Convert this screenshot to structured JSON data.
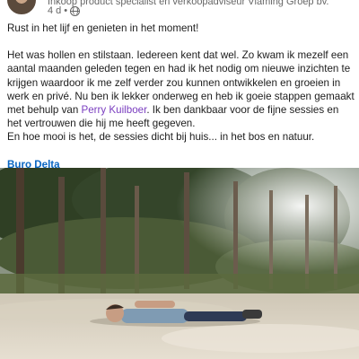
{
  "post": {
    "author_subtitle": "Inkoop product specialist en verkoopadviseur Vlaming Groep bv.",
    "time": "4 d",
    "separator": "•",
    "visibility_icon": "globe-icon",
    "line1": "Rust in het lijf en genieten in het moment!",
    "para2_part1": "Het was hollen en stilstaan. Iedereen kent dat wel. Zo kwam ik mezelf een aantal maanden geleden tegen en had ik het nodig om nieuwe inzichten te krijgen waardoor ik me zelf verder zou kunnen ontwikkelen en groeien in werk en privé. Nu ben ik lekker onderweg en heb ik goeie stappen gemaakt met behulp van ",
    "mention": "Perry Kuilboer",
    "para2_part2": ". Ik ben dankbaar voor de fijne sessies en het vertrouwen die hij me heeft gegeven.",
    "line3": "En hoe mooi is het, de sessies dicht bij huis... in het bos en natuur.",
    "hashtag": "Buro Delta"
  },
  "colors": {
    "mention": "#7b3fc0",
    "link": "#0a66c2",
    "text": "#1c1c1c",
    "meta": "#666666"
  }
}
